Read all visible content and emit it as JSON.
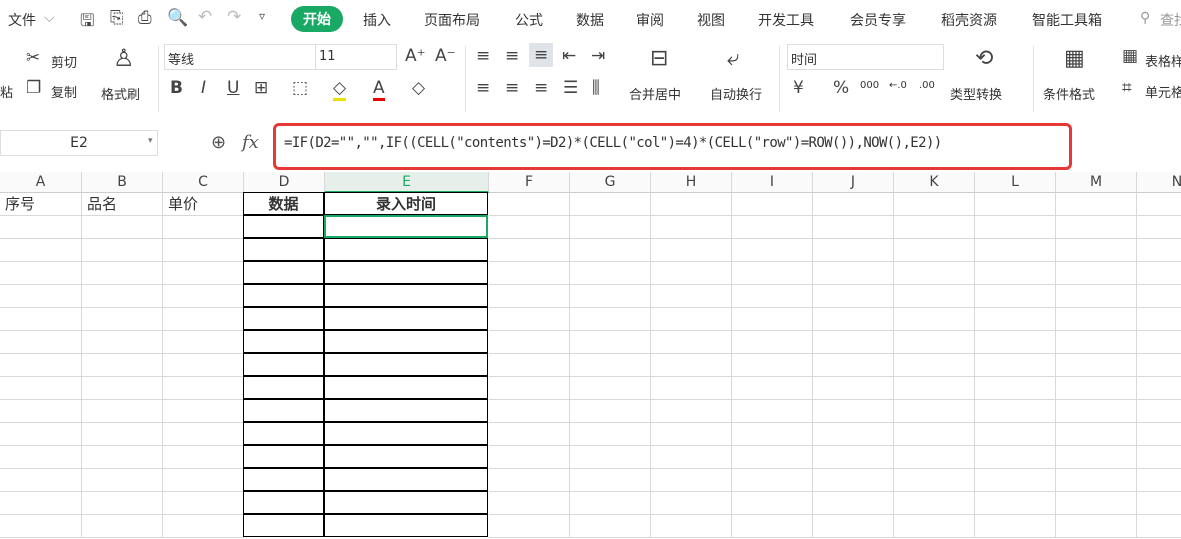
{
  "menu": {
    "file": "文件",
    "tabs": [
      "开始",
      "插入",
      "页面布局",
      "公式",
      "数据",
      "审阅",
      "视图",
      "开发工具",
      "会员专享",
      "稻壳资源",
      "智能工具箱"
    ],
    "search": "查找"
  },
  "ribbon": {
    "paste": "粘",
    "cut": "剪切",
    "copy": "复制",
    "format_painter": "格式刷",
    "font": "等线",
    "size": "11",
    "merge": "合并居中",
    "wrap": "自动换行",
    "number_format": "时间",
    "currency": "¥",
    "percent": "%",
    "thousands": "000",
    "inc_dec": "←.0",
    "dec_dec": ".00",
    "convert": "类型转换",
    "cond_format": "条件格式",
    "table_style": "表格样式",
    "cell": "单元格"
  },
  "formula_bar": {
    "name_box": "E2",
    "fx": "fx",
    "formula": "=IF(D2=\"\",\"\",IF((CELL(\"contents\")=D2)*(CELL(\"col\")=4)*(CELL(\"row\")=ROW()),NOW(),E2))"
  },
  "sheet": {
    "columns": [
      "A",
      "B",
      "C",
      "D",
      "E",
      "F",
      "G",
      "H",
      "I",
      "J",
      "K",
      "L",
      "M",
      "N"
    ],
    "header_row": [
      "序号",
      "品名",
      "单价",
      "数据",
      "录入时间"
    ],
    "selected": "E2"
  },
  "colors": {
    "accent": "#1aa865",
    "highlight": "#e53935"
  }
}
